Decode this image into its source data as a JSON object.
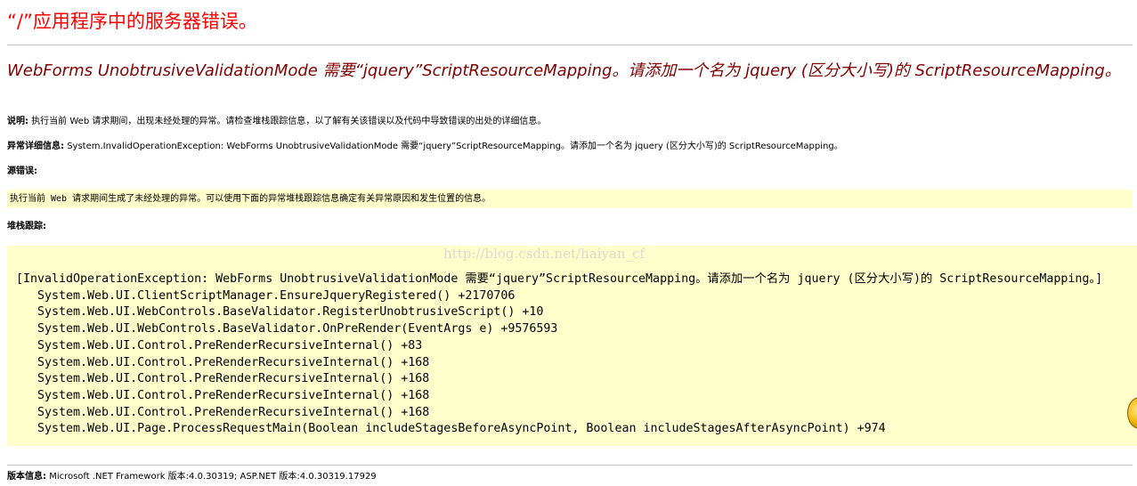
{
  "header": {
    "title": "“/”应用程序中的服务器错误。"
  },
  "error": {
    "subtitle": "WebForms UnobtrusiveValidationMode 需要“jquery”ScriptResourceMapping。请添加一个名为 jquery (区分大小写)的 ScriptResourceMapping。",
    "description_label": "说明:",
    "description_text": "执行当前 Web 请求期间，出现未经处理的异常。请检查堆栈跟踪信息，以了解有关该错误以及代码中导致错误的出处的详细信息。",
    "exception_label": "异常详细信息:",
    "exception_text": "System.InvalidOperationException: WebForms UnobtrusiveValidationMode 需要“jquery”ScriptResourceMapping。请添加一个名为 jquery (区分大小写)的 ScriptResourceMapping。",
    "source_label": "源错误:",
    "source_text": "执行当前 Web 请求期间生成了未经处理的异常。可以使用下面的异常堆栈跟踪信息确定有关异常原因和发生位置的信息。",
    "stack_label": "堆栈跟踪:",
    "watermark": "http://blog.csdn.net/haiyan_cf",
    "stack_lines": [
      "[InvalidOperationException: WebForms UnobtrusiveValidationMode 需要“jquery”ScriptResourceMapping。请添加一个名为 jquery (区分大小写)的 ScriptResourceMapping。]",
      "System.Web.UI.ClientScriptManager.EnsureJqueryRegistered() +2170706",
      "System.Web.UI.WebControls.BaseValidator.RegisterUnobtrusiveScript() +10",
      "System.Web.UI.WebControls.BaseValidator.OnPreRender(EventArgs e) +9576593",
      "System.Web.UI.Control.PreRenderRecursiveInternal() +83",
      "System.Web.UI.Control.PreRenderRecursiveInternal() +168",
      "System.Web.UI.Control.PreRenderRecursiveInternal() +168",
      "System.Web.UI.Control.PreRenderRecursiveInternal() +168",
      "System.Web.UI.Control.PreRenderRecursiveInternal() +168",
      "System.Web.UI.Page.ProcessRequestMain(Boolean includeStagesBeforeAsyncPoint, Boolean includeStagesAfterAsyncPoint) +974"
    ],
    "version_label": "版本信息:",
    "version_text": "Microsoft .NET Framework 版本:4.0.30319; ASP.NET 版本:4.0.30319.17929"
  },
  "colors": {
    "title_red": "#ff0000",
    "subtitle_maroon": "#800000",
    "code_background": "#ffffcc",
    "rule_gray": "#c0c0c0"
  },
  "icons": {
    "corner": "floating-helper-icon"
  }
}
